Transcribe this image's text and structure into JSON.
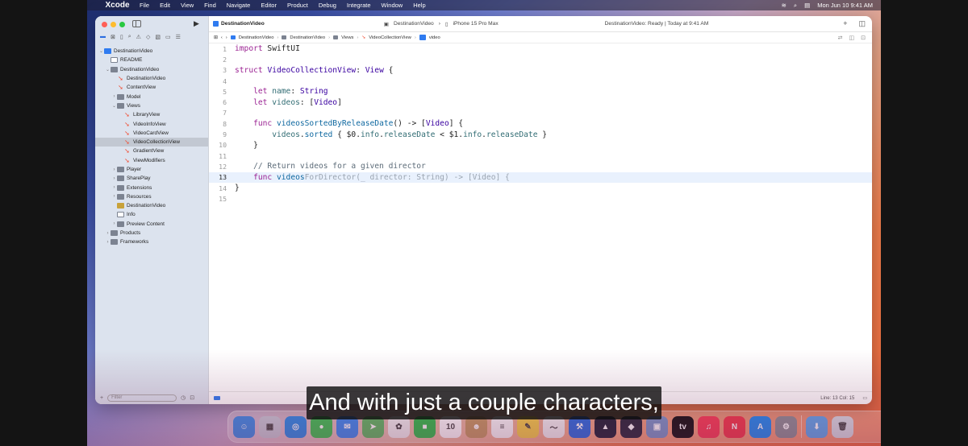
{
  "menubar": {
    "app": "Xcode",
    "items": [
      "File",
      "Edit",
      "View",
      "Find",
      "Navigate",
      "Editor",
      "Product",
      "Debug",
      "Integrate",
      "Window",
      "Help"
    ],
    "clock": "Mon Jun 10  9:41 AM"
  },
  "toolbar": {
    "tab_title": "DestinationVideo",
    "scheme": "DestinationVideo",
    "destination": "iPhone 15 Pro Max",
    "status": "DestinationVideo: Ready | Today at 9:41 AM"
  },
  "jumpbar": {
    "crumbs": [
      "DestinationVideo",
      "DestinationVideo",
      "Views",
      "VideoCollectionView",
      "video"
    ]
  },
  "navigator": {
    "tree": [
      {
        "label": "DestinationVideo",
        "icon": "project-icon",
        "indent": 0,
        "chev": "⌄"
      },
      {
        "label": "README",
        "icon": "doc-icon",
        "indent": 1,
        "chev": ""
      },
      {
        "label": "DestinationVideo",
        "icon": "folder-icon",
        "indent": 1,
        "chev": "⌄"
      },
      {
        "label": "DestinationVideo",
        "icon": "swift-icon",
        "indent": 2,
        "chev": ""
      },
      {
        "label": "ContentView",
        "icon": "swift-icon",
        "indent": 2,
        "chev": ""
      },
      {
        "label": "Model",
        "icon": "folder-icon",
        "indent": 2,
        "chev": "›"
      },
      {
        "label": "Views",
        "icon": "folder-icon",
        "indent": 2,
        "chev": "⌄"
      },
      {
        "label": "LibraryView",
        "icon": "swift-icon",
        "indent": 3,
        "chev": ""
      },
      {
        "label": "VideoInfoView",
        "icon": "swift-icon",
        "indent": 3,
        "chev": ""
      },
      {
        "label": "VideoCardView",
        "icon": "swift-icon",
        "indent": 3,
        "chev": ""
      },
      {
        "label": "VideoCollectionView",
        "icon": "swift-icon",
        "indent": 3,
        "chev": "",
        "selected": true
      },
      {
        "label": "GradientView",
        "icon": "swift-icon",
        "indent": 3,
        "chev": ""
      },
      {
        "label": "ViewModifiers",
        "icon": "swift-icon",
        "indent": 3,
        "chev": ""
      },
      {
        "label": "Player",
        "icon": "folder-icon",
        "indent": 2,
        "chev": "›"
      },
      {
        "label": "SharePlay",
        "icon": "folder-icon",
        "indent": 2,
        "chev": "›"
      },
      {
        "label": "Extensions",
        "icon": "folder-icon",
        "indent": 2,
        "chev": "›"
      },
      {
        "label": "Resources",
        "icon": "folder-icon",
        "indent": 2,
        "chev": "›"
      },
      {
        "label": "DestinationVideo",
        "icon": "asset-icon",
        "indent": 2,
        "chev": ""
      },
      {
        "label": "Info",
        "icon": "doc-icon",
        "indent": 2,
        "chev": ""
      },
      {
        "label": "Preview Content",
        "icon": "folder-icon",
        "indent": 2,
        "chev": "›"
      },
      {
        "label": "Products",
        "icon": "folder-icon",
        "indent": 1,
        "chev": "›"
      },
      {
        "label": "Frameworks",
        "icon": "folder-icon",
        "indent": 1,
        "chev": "›"
      }
    ],
    "filter_placeholder": "Filter"
  },
  "code": {
    "lines": [
      [
        [
          "kw",
          "import"
        ],
        [
          "pl",
          " SwiftUI"
        ]
      ],
      [],
      [
        [
          "kw",
          "struct"
        ],
        [
          "pl",
          " "
        ],
        [
          "ty",
          "VideoCollectionView"
        ],
        [
          "pl",
          ": "
        ],
        [
          "ty",
          "View"
        ],
        [
          "pl",
          " {"
        ]
      ],
      [],
      [
        [
          "pl",
          "    "
        ],
        [
          "kw",
          "let"
        ],
        [
          "pl",
          " "
        ],
        [
          "pr",
          "name"
        ],
        [
          "pl",
          ": "
        ],
        [
          "ty",
          "String"
        ]
      ],
      [
        [
          "pl",
          "    "
        ],
        [
          "kw",
          "let"
        ],
        [
          "pl",
          " "
        ],
        [
          "pr",
          "videos"
        ],
        [
          "pl",
          ": ["
        ],
        [
          "ty",
          "Video"
        ],
        [
          "pl",
          "]"
        ]
      ],
      [],
      [
        [
          "pl",
          "    "
        ],
        [
          "kw",
          "func"
        ],
        [
          "pl",
          " "
        ],
        [
          "fn",
          "videosSortedByReleaseDate"
        ],
        [
          "pl",
          "() -> ["
        ],
        [
          "ty",
          "Video"
        ],
        [
          "pl",
          "] {"
        ]
      ],
      [
        [
          "pl",
          "        "
        ],
        [
          "pr",
          "videos"
        ],
        [
          "pl",
          "."
        ],
        [
          "fn",
          "sorted"
        ],
        [
          "pl",
          " { $0."
        ],
        [
          "pr",
          "info"
        ],
        [
          "pl",
          "."
        ],
        [
          "pr",
          "releaseDate"
        ],
        [
          "pl",
          " < $1."
        ],
        [
          "pr",
          "info"
        ],
        [
          "pl",
          "."
        ],
        [
          "pr",
          "releaseDate"
        ],
        [
          "pl",
          " }"
        ]
      ],
      [
        [
          "pl",
          "    }"
        ]
      ],
      [],
      [
        [
          "cm",
          "    // Return videos for a given director"
        ]
      ],
      [
        [
          "pl",
          "    "
        ],
        [
          "kw",
          "func"
        ],
        [
          "pl",
          " "
        ],
        [
          "fn",
          "videos"
        ],
        [
          "ghost",
          "ForDirector(_ director: String) -> [Video] {"
        ]
      ],
      [
        [
          "pl",
          "}"
        ]
      ],
      []
    ],
    "current_line": 13
  },
  "editor_status": {
    "position": "Line: 13  Col: 15"
  },
  "caption": "And with just a couple characters,",
  "dock": {
    "apps": [
      {
        "name": "finder-icon",
        "color": "#3d8ee8",
        "glyph": "☺"
      },
      {
        "name": "launchpad-icon",
        "color": "#c8ccd8",
        "glyph": "▦"
      },
      {
        "name": "safari-icon",
        "color": "#2c8ce8",
        "glyph": "◎"
      },
      {
        "name": "messages-icon",
        "color": "#3cc453",
        "glyph": "●"
      },
      {
        "name": "mail-icon",
        "color": "#3b8cf2",
        "glyph": "✉"
      },
      {
        "name": "maps-icon",
        "color": "#5dbb63",
        "glyph": "➤"
      },
      {
        "name": "photos-icon",
        "color": "#f3f3f3",
        "glyph": "✿"
      },
      {
        "name": "facetime-icon",
        "color": "#2fbf4a",
        "glyph": "■"
      },
      {
        "name": "calendar-icon",
        "color": "#ffffff",
        "glyph": "10"
      },
      {
        "name": "contacts-icon",
        "color": "#c59a62",
        "glyph": "☻"
      },
      {
        "name": "reminders-icon",
        "color": "#fbfbfb",
        "glyph": "≡"
      },
      {
        "name": "notes-icon",
        "color": "#f5cf48",
        "glyph": "✎"
      },
      {
        "name": "freeform-icon",
        "color": "#f4f4f4",
        "glyph": "〜"
      },
      {
        "name": "xcode-icon",
        "color": "#2a6de0",
        "glyph": "⚒"
      },
      {
        "name": "instruments-icon",
        "color": "#1e2236",
        "glyph": "▲"
      },
      {
        "name": "simulator-icon",
        "color": "#27283a",
        "glyph": "◆"
      },
      {
        "name": "preview-icon",
        "color": "#7a96c8",
        "glyph": "▣"
      },
      {
        "name": "tv-icon",
        "color": "#111111",
        "glyph": "tv"
      },
      {
        "name": "music-icon",
        "color": "#fa3d55",
        "glyph": "♫"
      },
      {
        "name": "news-icon",
        "color": "#f3384a",
        "glyph": "N"
      },
      {
        "name": "appstore-icon",
        "color": "#1f8bf2",
        "glyph": "A"
      },
      {
        "name": "settings-icon",
        "color": "#8d8f95",
        "glyph": "⚙"
      }
    ],
    "trailing": [
      {
        "name": "downloads-icon",
        "color": "#5fa7ec",
        "glyph": "⬇"
      },
      {
        "name": "trash-icon",
        "color": "#d8dde4",
        "glyph": "🗑"
      }
    ]
  }
}
